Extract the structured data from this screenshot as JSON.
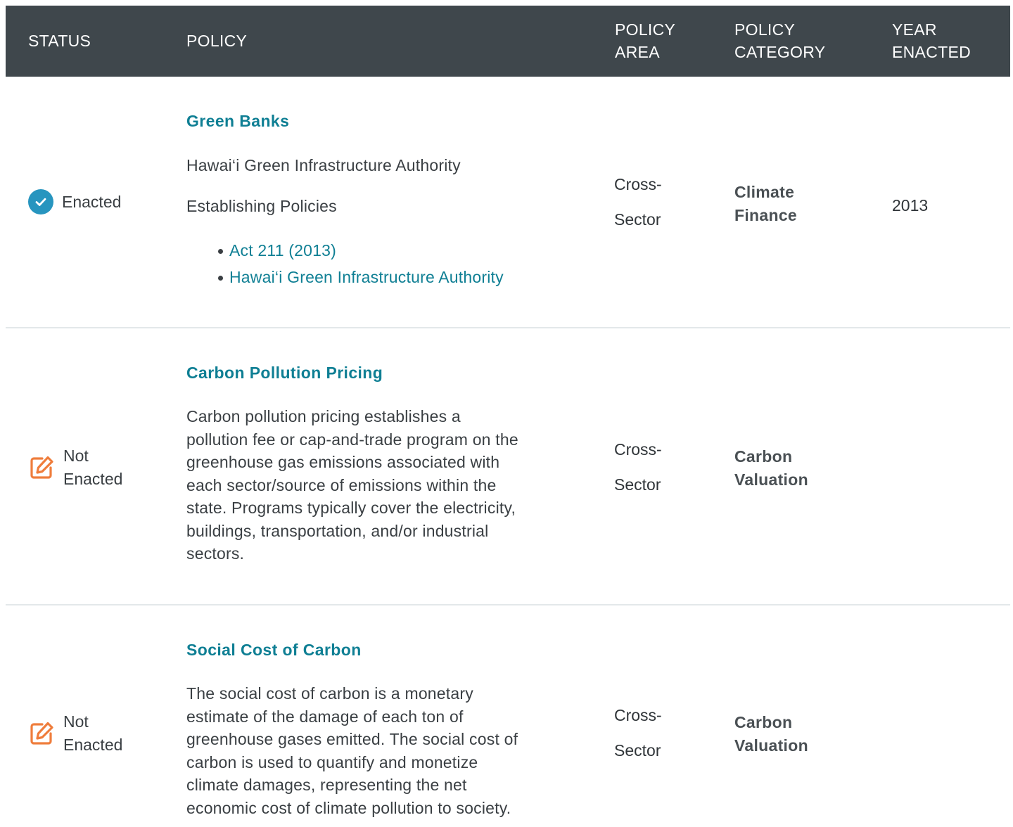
{
  "header": {
    "status": "STATUS",
    "policy": "POLICY",
    "policy_area_line1": "POLICY",
    "policy_area_line2": "AREA",
    "policy_category_line1": "POLICY",
    "policy_category_line2": "CATEGORY",
    "year_line1": "YEAR",
    "year_line2": "ENACTED"
  },
  "colors": {
    "header_bg": "#3f474c",
    "link": "#0f7f94",
    "enacted_icon": "#2795bf",
    "not_enacted_icon": "#ef7d3c"
  },
  "rows": [
    {
      "status": "Enacted",
      "status_icon": "check-circle-icon",
      "title": "Green Banks",
      "description": "Hawai‘i Green Infrastructure Authority",
      "subheading": "Establishing Policies",
      "links": [
        "Act 211 (2013)",
        "Hawai‘i Green Infrastructure Authority"
      ],
      "area_line1": "Cross-",
      "area_line2": "Sector",
      "category_line1": "Climate",
      "category_line2": "Finance",
      "year": "2013"
    },
    {
      "status_line1": "Not",
      "status_line2": "Enacted",
      "status_icon": "edit-icon",
      "title": "Carbon Pollution Pricing",
      "description_lines": [
        "Carbon pollution pricing establishes a",
        "pollution fee or cap-and-trade program on the",
        "greenhouse gas emissions associated with",
        "each sector/source of emissions within the",
        "state. Programs typically cover the electricity,",
        "buildings, transportation, and/or industrial",
        "sectors."
      ],
      "area_line1": "Cross-",
      "area_line2": "Sector",
      "category_line1": "Carbon",
      "category_line2": "Valuation",
      "year": ""
    },
    {
      "status_line1": "Not",
      "status_line2": "Enacted",
      "status_icon": "edit-icon",
      "title": "Social Cost of Carbon",
      "description_lines": [
        "The social cost of carbon is a monetary",
        "estimate of the damage of each ton of",
        "greenhouse gases emitted. The social cost of",
        "carbon is used to quantify and monetize",
        "climate damages, representing the net",
        "economic cost of climate pollution to society."
      ],
      "area_line1": "Cross-",
      "area_line2": "Sector",
      "category_line1": "Carbon",
      "category_line2": "Valuation",
      "year": ""
    }
  ]
}
